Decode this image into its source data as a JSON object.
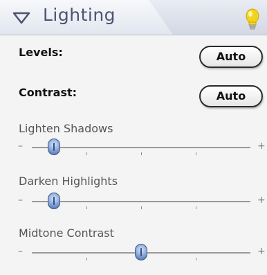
{
  "header": {
    "title": "Lighting",
    "disclosure_icon": "triangle-down-icon",
    "bulb_icon": "lightbulb-icon",
    "bulb_color": "#f2d41e"
  },
  "levels": {
    "label": "Levels:",
    "button_label": "Auto"
  },
  "contrast": {
    "label": "Contrast:",
    "button_label": "Auto"
  },
  "sliders": [
    {
      "label": "Lighten Shadows",
      "min_symbol": "–",
      "max_symbol": "+",
      "value": 0.1
    },
    {
      "label": "Darken Highlights",
      "min_symbol": "–",
      "max_symbol": "+",
      "value": 0.1
    },
    {
      "label": "Midtone Contrast",
      "min_symbol": "–",
      "max_symbol": "+",
      "value": 0.5
    }
  ]
}
